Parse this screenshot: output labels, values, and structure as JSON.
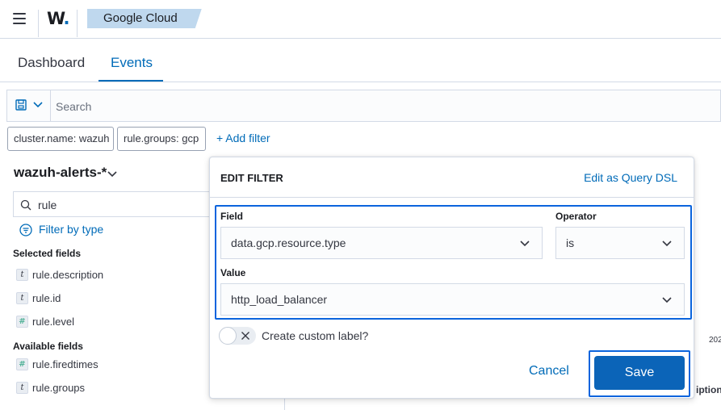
{
  "header": {
    "logo_text": "W",
    "logo_dot": ".",
    "breadcrumb": "Google Cloud"
  },
  "tabs": [
    {
      "label": "Dashboard",
      "active": false
    },
    {
      "label": "Events",
      "active": true
    }
  ],
  "query_bar": {
    "placeholder": "Search"
  },
  "filters": [
    {
      "label": "cluster.name: wazuh"
    },
    {
      "label": "rule.groups: gcp"
    }
  ],
  "add_filter_label": "+ Add filter",
  "sidebar": {
    "index_pattern": "wazuh-alerts-*",
    "field_search_value": "rule",
    "filter_by_type_label": "Filter by type",
    "selected_title": "Selected fields",
    "selected_fields": [
      {
        "type": "t",
        "name": "rule.description"
      },
      {
        "type": "t",
        "name": "rule.id"
      },
      {
        "type": "#",
        "name": "rule.level"
      }
    ],
    "available_title": "Available fields",
    "available_fields": [
      {
        "type": "#",
        "name": "rule.firedtimes"
      },
      {
        "type": "t",
        "name": "rule.groups"
      }
    ]
  },
  "background_peek": {
    "timestamp_fragment": "202",
    "column_fragment": "iption"
  },
  "edit_filter": {
    "title": "EDIT FILTER",
    "edit_dsl_label": "Edit as Query DSL",
    "field_label": "Field",
    "field_value": "data.gcp.resource.type",
    "operator_label": "Operator",
    "operator_value": "is",
    "value_label": "Value",
    "value_value": "http_load_balancer",
    "custom_label_text": "Create custom label?",
    "custom_label_enabled": false,
    "cancel_label": "Cancel",
    "save_label": "Save"
  },
  "colors": {
    "accent": "#006bb8",
    "focus": "#0b64dd",
    "breadcrumb_bg": "#bfd8ee"
  }
}
